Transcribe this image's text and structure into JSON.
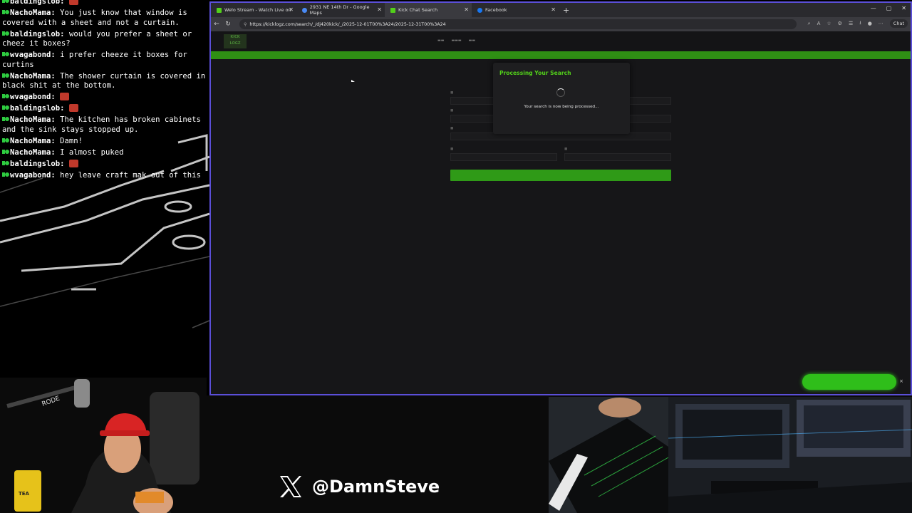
{
  "chat": {
    "messages": [
      {
        "user": "baldingslob:",
        "text": "",
        "emote": true,
        "badge_color": "#2ecc40"
      },
      {
        "user": "NachoMama:",
        "text": "You just know that window is covered with a sheet and not a curtain.",
        "emote": false,
        "badge_color": "#2ecc40"
      },
      {
        "user": "baldingslob:",
        "text": "would you prefer a sheet or cheez it boxes?",
        "emote": false,
        "badge_color": "#2ecc40"
      },
      {
        "user": "wvagabond:",
        "text": "i prefer cheeze it boxes for curtins",
        "emote": false,
        "badge_color": "#2ecc40"
      },
      {
        "user": "NachoMama:",
        "text": "The shower curtain is covered in black shit at the bottom.",
        "emote": false,
        "badge_color": "#2ecc40"
      },
      {
        "user": "wvagabond:",
        "text": "",
        "emote": true,
        "badge_color": "#2ecc40"
      },
      {
        "user": "baldingslob:",
        "text": "",
        "emote": true,
        "badge_color": "#2ecc40"
      },
      {
        "user": "NachoMama:",
        "text": "The kitchen has broken cabinets and the sink stays stopped up.",
        "emote": false,
        "badge_color": "#2ecc40"
      },
      {
        "user": "NachoMama:",
        "text": "Damn!",
        "emote": false,
        "badge_color": "#2ecc40"
      },
      {
        "user": "NachoMama:",
        "text": "I almost puked",
        "emote": false,
        "badge_color": "#2ecc40"
      },
      {
        "user": "baldingslob:",
        "text": "",
        "emote": true,
        "badge_color": "#2ecc40"
      },
      {
        "user": "wvagabond:",
        "text": "hey leave craft mak out of this",
        "emote": false,
        "badge_color": "#2ecc40"
      }
    ]
  },
  "browser": {
    "tabs": [
      {
        "label": "Welo Stream - Watch Live on",
        "color": "#52d01a",
        "active": false
      },
      {
        "label": "2931 NE 14th Dr - Google Maps",
        "color": "#4a8af4",
        "active": false
      },
      {
        "label": "Kick Chat Search",
        "color": "#52d01a",
        "active": true
      },
      {
        "label": "Facebook",
        "color": "#1877f2",
        "active": false
      }
    ],
    "url": "https://kicklogz.com/search/_/dj420kick/_/2025-12-01T00%3A24/2025-12-31T00%3A24",
    "chat_button": "Chat"
  },
  "modal": {
    "title": "Processing Your Search",
    "text": "Your search is now being processed..."
  },
  "overlay": {
    "handle": "@DamnSteve"
  },
  "colors": {
    "accent": "#52d01a",
    "border": "#5b4fd8"
  }
}
